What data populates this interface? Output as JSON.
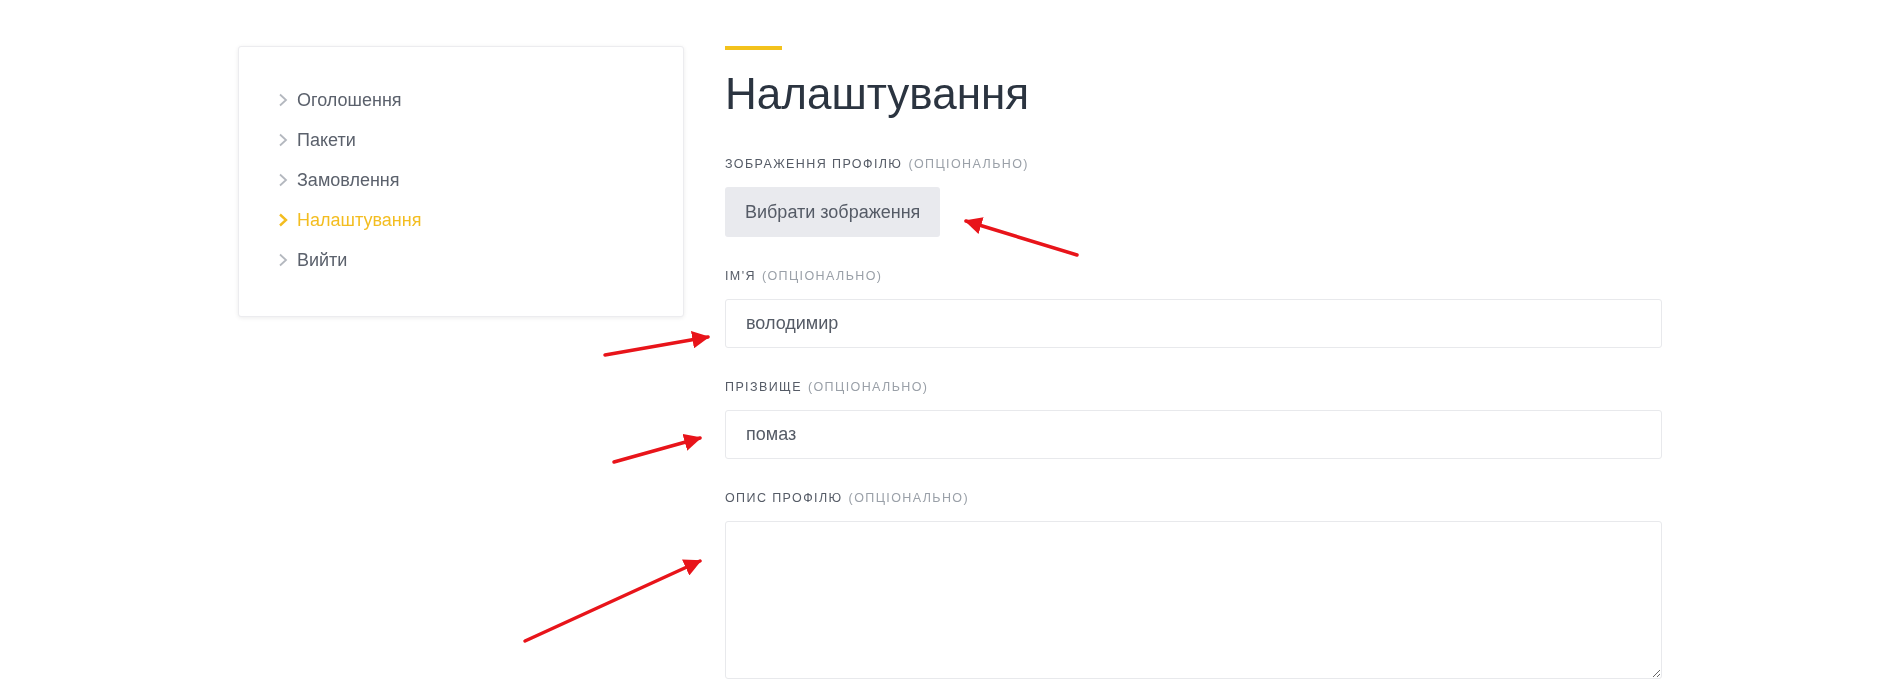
{
  "sidebar": {
    "items": [
      {
        "label": "Оголошення",
        "selected": false
      },
      {
        "label": "Пакети",
        "selected": false
      },
      {
        "label": "Замовлення",
        "selected": false
      },
      {
        "label": "Налаштування",
        "selected": true
      },
      {
        "label": "Вийти",
        "selected": false
      }
    ]
  },
  "title": "Налаштування",
  "fields": [
    {
      "kind": "file",
      "label": "ЗОБРАЖЕННЯ ПРОФІЛЮ",
      "note": "(ОПЦІОНАЛЬНО)",
      "button": "Вибрати зображення"
    },
    {
      "kind": "input",
      "label": "ІМ'Я",
      "note": "(ОПЦІОНАЛЬНО)",
      "value": "володимир"
    },
    {
      "kind": "input",
      "label": "ПРІЗВИЩЕ",
      "note": "(ОПЦІОНАЛЬНО)",
      "value": "помаз"
    },
    {
      "kind": "textarea",
      "label": "ОПИС ПРОФІЛЮ",
      "note": "(ОПЦІОНАЛЬНО)"
    }
  ]
}
